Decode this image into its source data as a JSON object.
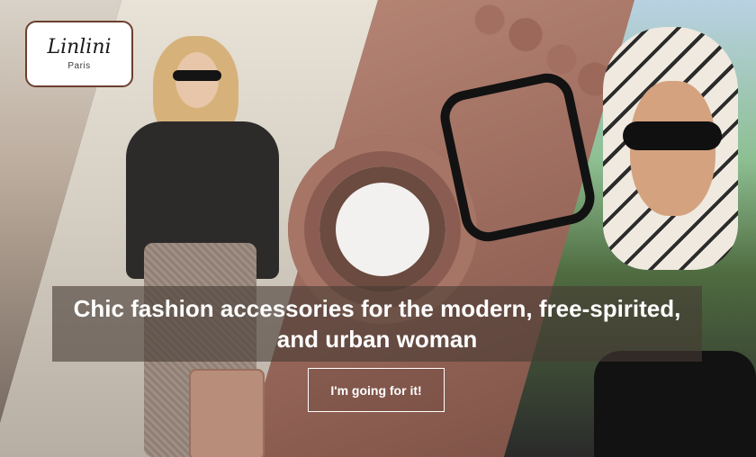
{
  "brand": {
    "name": "Linlini",
    "sub": "Paris"
  },
  "hero": {
    "headline": "Chic fashion accessories for the modern, free-spirited, and urban woman",
    "cta_label": "I'm going for it!"
  },
  "colors": {
    "logo_border": "#6a3f2f",
    "overlay": "#463a34",
    "text": "#ffffff"
  }
}
